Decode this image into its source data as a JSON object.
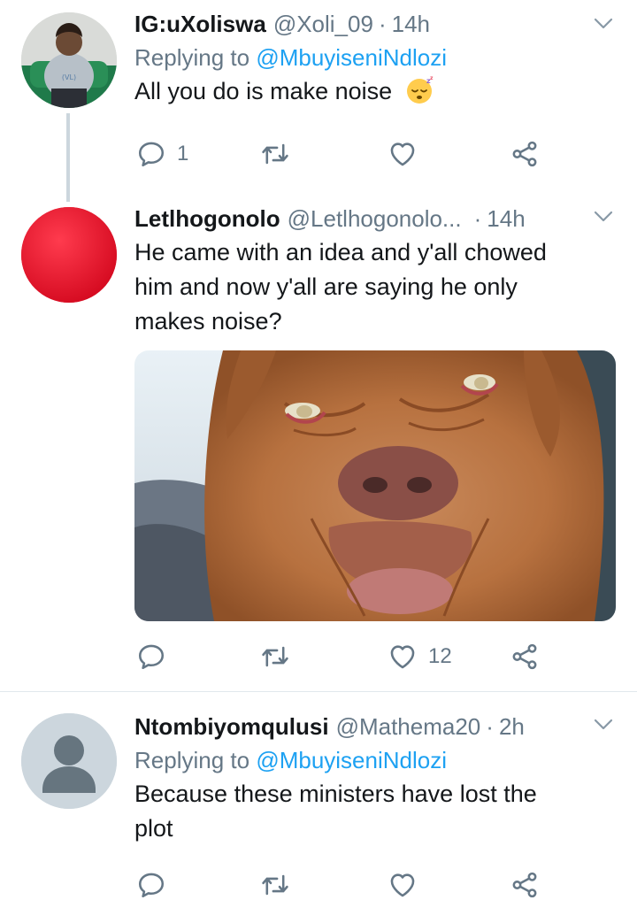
{
  "tweets": [
    {
      "name": "IG:uXoliswa",
      "handle": "@Xoli_09",
      "dot": "·",
      "time": "14h",
      "replying_prefix": "Replying to ",
      "replying_to": "@MbuyiseniNdlozi",
      "text": "All you do is make noise",
      "reply_count": "1",
      "retweet_count": "",
      "like_count": "",
      "emoji": "sleeping-face"
    },
    {
      "name": "Letlhogonolo",
      "handle": "@Letlhogonolo...",
      "dot": "·",
      "time": "14h",
      "text_lines": [
        "He came with an idea and y'all chowed",
        "him and now y'all are saying he only",
        "makes noise?"
      ],
      "reply_count": "",
      "retweet_count": "",
      "like_count": "12",
      "media": "dog-photo"
    },
    {
      "name": "Ntombiyomqulusi",
      "handle": "@Mathema20",
      "dot": "·",
      "time": "2h",
      "replying_prefix": "Replying to ",
      "replying_to": "@MbuyiseniNdlozi",
      "text_lines": [
        "Because these ministers have lost the",
        "plot"
      ],
      "reply_count": "",
      "retweet_count": "",
      "like_count": ""
    }
  ],
  "colors": {
    "secondary_text": "#657786",
    "link": "#1da1f2",
    "thread_line": "#ccd6dd",
    "divider": "#e1e8ed",
    "avatar_red": "#e0192f",
    "default_avatar_bg": "#ccd6dd"
  },
  "icons": [
    "reply-icon",
    "retweet-icon",
    "like-icon",
    "share-icon",
    "chevron-down-icon"
  ]
}
